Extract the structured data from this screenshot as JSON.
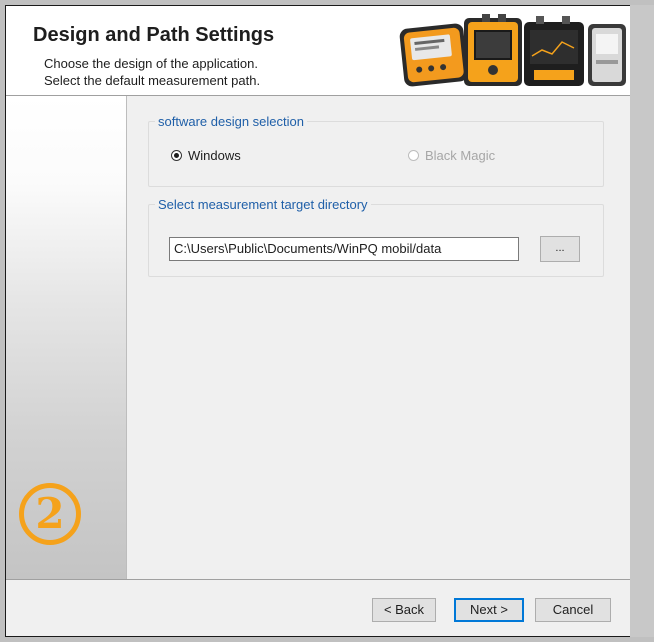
{
  "header": {
    "title": "Design and Path Settings",
    "subtitle_line1": "Choose the design of the application.",
    "subtitle_line2": "Select the default measurement path."
  },
  "sidebar": {
    "step_number": "2"
  },
  "design_group": {
    "legend": "software design selection",
    "options": [
      {
        "label": "Windows",
        "selected": true,
        "enabled": true
      },
      {
        "label": "Black Magic",
        "selected": false,
        "enabled": false
      }
    ]
  },
  "path_group": {
    "legend": "Select measurement target directory",
    "path_value": "C:\\Users\\Public\\Documents/WinPQ mobil/data",
    "browse_label": "..."
  },
  "footer": {
    "back_label": "< Back",
    "next_label": "Next >",
    "cancel_label": "Cancel"
  },
  "colors": {
    "accent_orange": "#f5a21b",
    "legend_blue": "#1f5fa8",
    "focus_blue": "#0078d7"
  },
  "icons": {
    "devices": "measurement-devices-image",
    "step": "step-2-circle-icon"
  }
}
